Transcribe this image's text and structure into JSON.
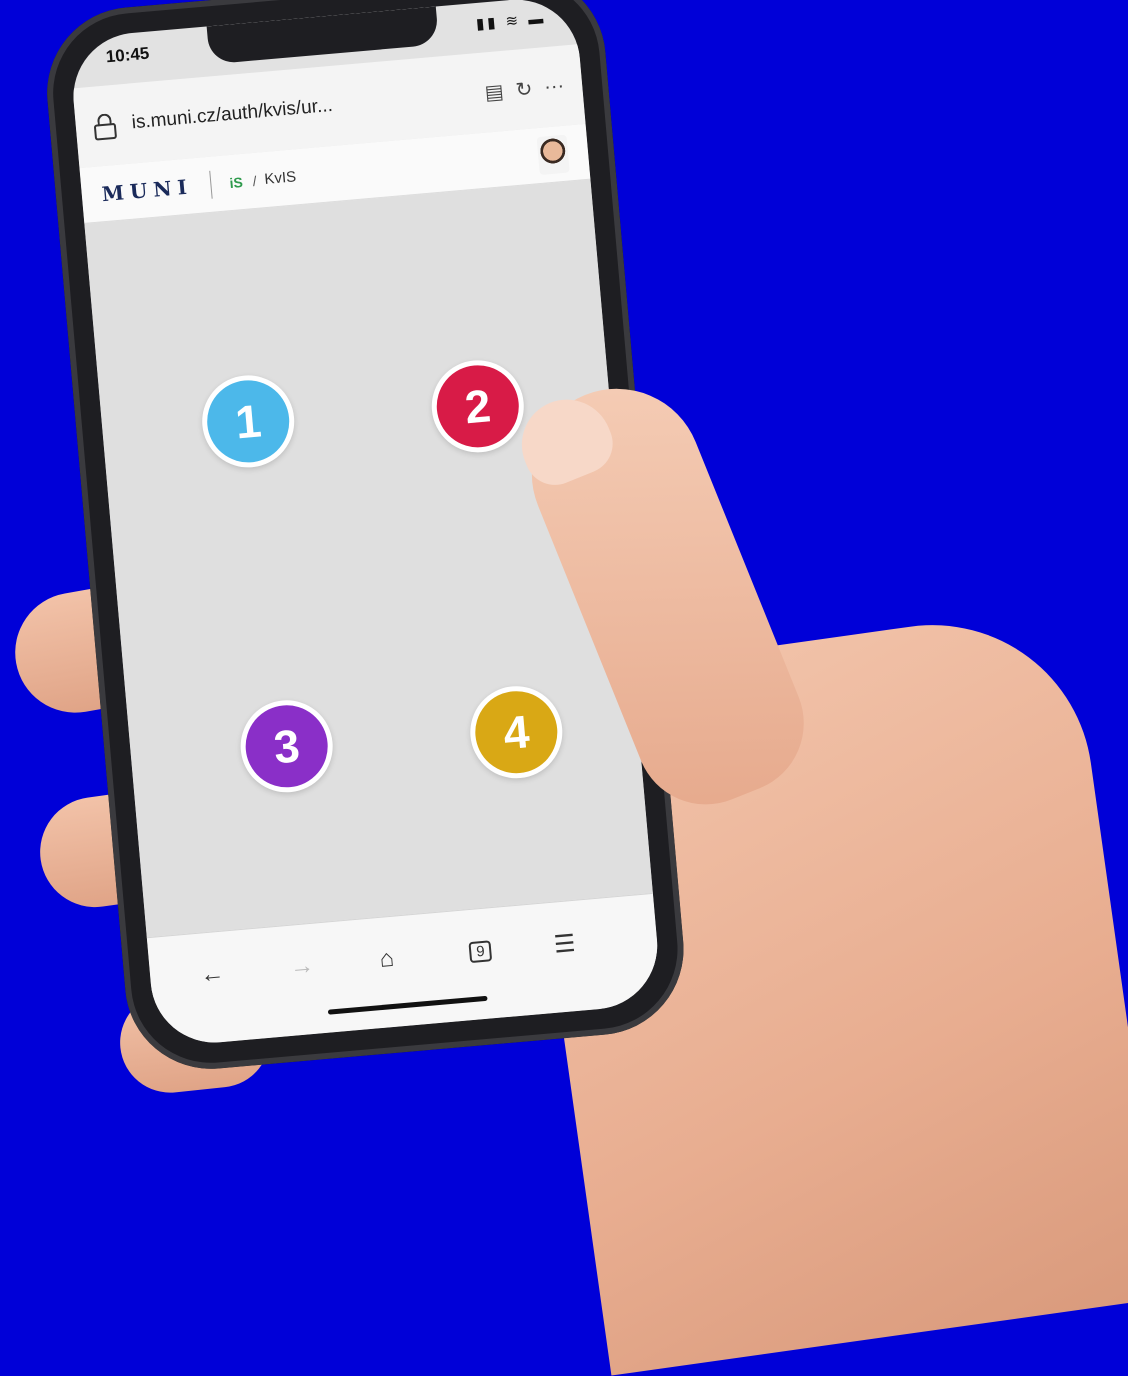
{
  "colors": {
    "background": "#0000d8",
    "circle_1": "#4cb8ea",
    "circle_2": "#d81b47",
    "circle_3": "#8a2fc8",
    "circle_4": "#d9a815"
  },
  "status_bar": {
    "time": "10:45",
    "icons": "signal-icon wifi-icon battery-icon"
  },
  "browser": {
    "url": "is.muni.cz/auth/kvis/ur...",
    "reader_icon": "reader-icon",
    "reload_icon": "reload-icon",
    "more_label": "···"
  },
  "site_header": {
    "logo": "MUNI",
    "is_logo": "iS",
    "separator": "/",
    "breadcrumb": "KvIS"
  },
  "circles": [
    {
      "label": "1"
    },
    {
      "label": "2"
    },
    {
      "label": "3"
    },
    {
      "label": "4"
    }
  ],
  "bottom_nav": {
    "back": "←",
    "forward": "→",
    "home": "⌂",
    "tabs_count": "9",
    "menu": "☰"
  }
}
